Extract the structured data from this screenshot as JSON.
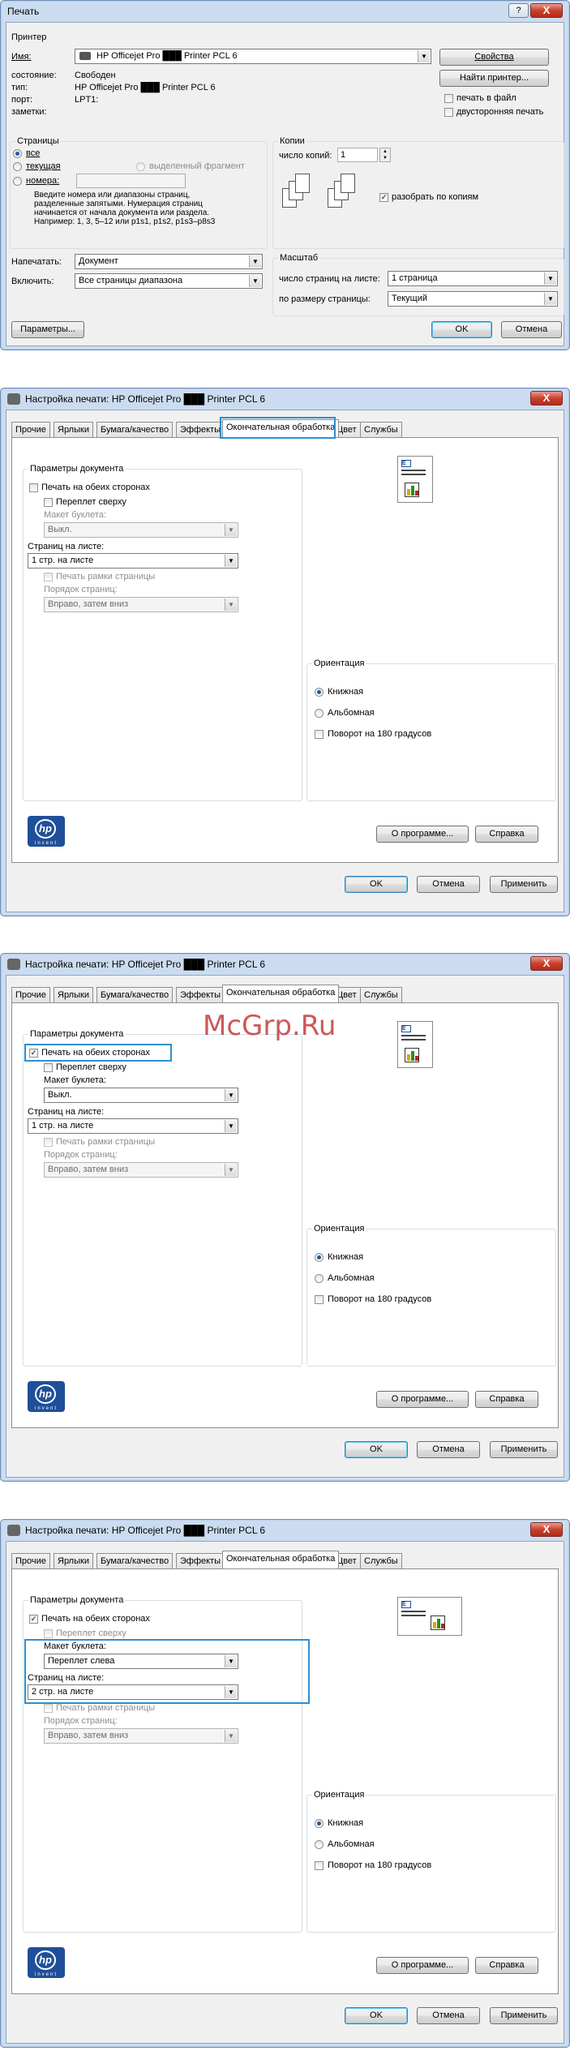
{
  "print_dialog": {
    "title": "Печать",
    "help_label": "?",
    "close_label": "X",
    "printer_group": "Принтер",
    "name_label": "Имя:",
    "name_value": "HP Officejet Pro ███ Printer PCL 6",
    "properties_btn": "Свойства",
    "status_label": "состояние:",
    "status_value": "Свободен",
    "type_label": "тип:",
    "type_value": "HP Officejet Pro ███ Printer PCL 6",
    "port_label": "порт:",
    "port_value": "LPT1:",
    "notes_label": "заметки:",
    "find_printer_btn": "Найти принтер...",
    "print_to_file": "печать в файл",
    "duplex": "двусторонняя печать",
    "pages_group": "Страницы",
    "all": "все",
    "current": "текущая",
    "selection": "выделенный фрагмент",
    "numbers": "номера:",
    "hint": [
      "Введите номера или диапазоны страниц,",
      "разделенные запятыми. Нумерация страниц",
      "начинается от начала документа или раздела.",
      "Например: 1, 3, 5–12 или p1s1, p1s2, p1s3–p8s3"
    ],
    "copies_group": "Копии",
    "copies_label": "число копий:",
    "copies_value": "1",
    "collate": "разобрать по копиям",
    "print_what_label": "Напечатать:",
    "print_what_value": "Документ",
    "include_label": "Включить:",
    "include_value": "Все страницы диапазона",
    "zoom_group": "Масштаб",
    "pages_per_sheet_label": "число страниц на листе:",
    "pages_per_sheet_value": "1 страница",
    "scale_label": "по размеру страницы:",
    "scale_value": "Текущий",
    "params_btn": "Параметры...",
    "ok_btn": "OK",
    "cancel_btn": "Отмена"
  },
  "prop_dialog": {
    "title": "Настройка печати: HP Officejet Pro ███ Printer PCL 6",
    "tabs": [
      "Прочие",
      "Ярлыки",
      "Бумага/качество",
      "Эффекты",
      "Окончательная обработка",
      "Цвет",
      "Службы"
    ],
    "doc_params": "Параметры документа",
    "duplex": "Печать на обеих сторонах",
    "flip_up": "Переплет сверху",
    "booklet_label": "Макет буклета:",
    "pages_per_sheet_label": "Страниц на листе:",
    "page_borders": "Печать рамки страницы",
    "page_order_label": "Порядок страниц:",
    "page_order_value": "Вправо, затем вниз",
    "orientation_group": "Ориентация",
    "portrait": "Книжная",
    "landscape": "Альбомная",
    "rotate": "Поворот на 180 градусов",
    "about_btn": "О программе...",
    "help_btn": "Справка",
    "ok_btn": "OK",
    "cancel_btn": "Отмена",
    "apply_btn": "Применить",
    "logo_text": "invent",
    "logo_mark": "hp"
  },
  "states": [
    {
      "booklet": "Выкл.",
      "pps": "1 стр. на листе"
    },
    {
      "booklet": "Выкл.",
      "pps": "1 стр. на листе"
    },
    {
      "booklet": "Переплет слева",
      "pps": "2 стр. на листе"
    }
  ],
  "watermark": "McGrp.Ru",
  "colors": {
    "accent": "#2e8fd0",
    "title_bar": "#ccdcf0"
  }
}
